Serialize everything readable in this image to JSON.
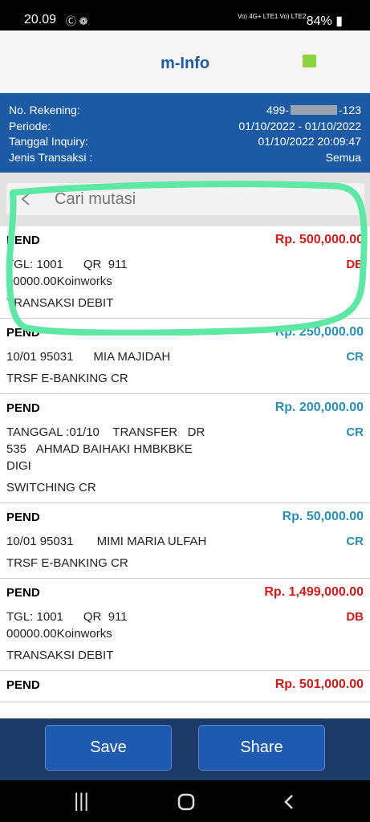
{
  "status_bar": {
    "time": "20.09",
    "network": "Vo) 4G+ LTE1 Vo) LTE2",
    "battery": "84%"
  },
  "app_bar": {
    "title": "m-Info",
    "accent_color": "#8cd43f"
  },
  "account_info": {
    "account_label": "No. Rekening:",
    "account_prefix": "499-",
    "account_suffix": "-123",
    "period_label": "Periode:",
    "period_value": "01/10/2022 - 01/10/2022",
    "inquiry_label": "Tanggal Inquiry:",
    "inquiry_value": "01/10/2022 20:09:47",
    "type_label": "Jenis Transaksi :",
    "type_value": "Semua"
  },
  "search": {
    "placeholder": "Cari mutasi",
    "icon": "back-arrow-icon"
  },
  "transactions": [
    {
      "status": "PEND",
      "amount": "Rp. 500,000.00",
      "type": "DB",
      "desc": "TGL: 1001      QR  911\n00000.00Koinworks",
      "kind": "TRANSAKSI DEBIT"
    },
    {
      "status": "PEND",
      "amount": "Rp. 250,000.00",
      "type": "CR",
      "desc": "10/01 95031      MIA MAJIDAH",
      "kind": "TRSF E-BANKING CR"
    },
    {
      "status": "PEND",
      "amount": "Rp. 200,000.00",
      "type": "CR",
      "desc": "TANGGAL :01/10    TRANSFER   DR\n535   AHMAD BAIHAKI HMBKBKE\nDIGI",
      "kind": "SWITCHING CR"
    },
    {
      "status": "PEND",
      "amount": "Rp. 50,000.00",
      "type": "CR",
      "desc": "10/01 95031       MIMI MARIA ULFAH",
      "kind": "TRSF E-BANKING CR"
    },
    {
      "status": "PEND",
      "amount": "Rp. 1,499,000.00",
      "type": "DB",
      "desc": "TGL: 1001      QR  911\n00000.00Koinworks",
      "kind": "TRANSAKSI DEBIT"
    },
    {
      "status": "PEND",
      "amount": "Rp. 501,000.00",
      "type": "DB",
      "desc": "",
      "kind": ""
    }
  ],
  "actions": {
    "save_label": "Save",
    "share_label": "Share"
  },
  "colors": {
    "header_blue": "#1c5aa6",
    "debit_red": "#d21a1a",
    "credit_blue": "#2a8fb8",
    "highlight_green": "#5fe8a5"
  }
}
